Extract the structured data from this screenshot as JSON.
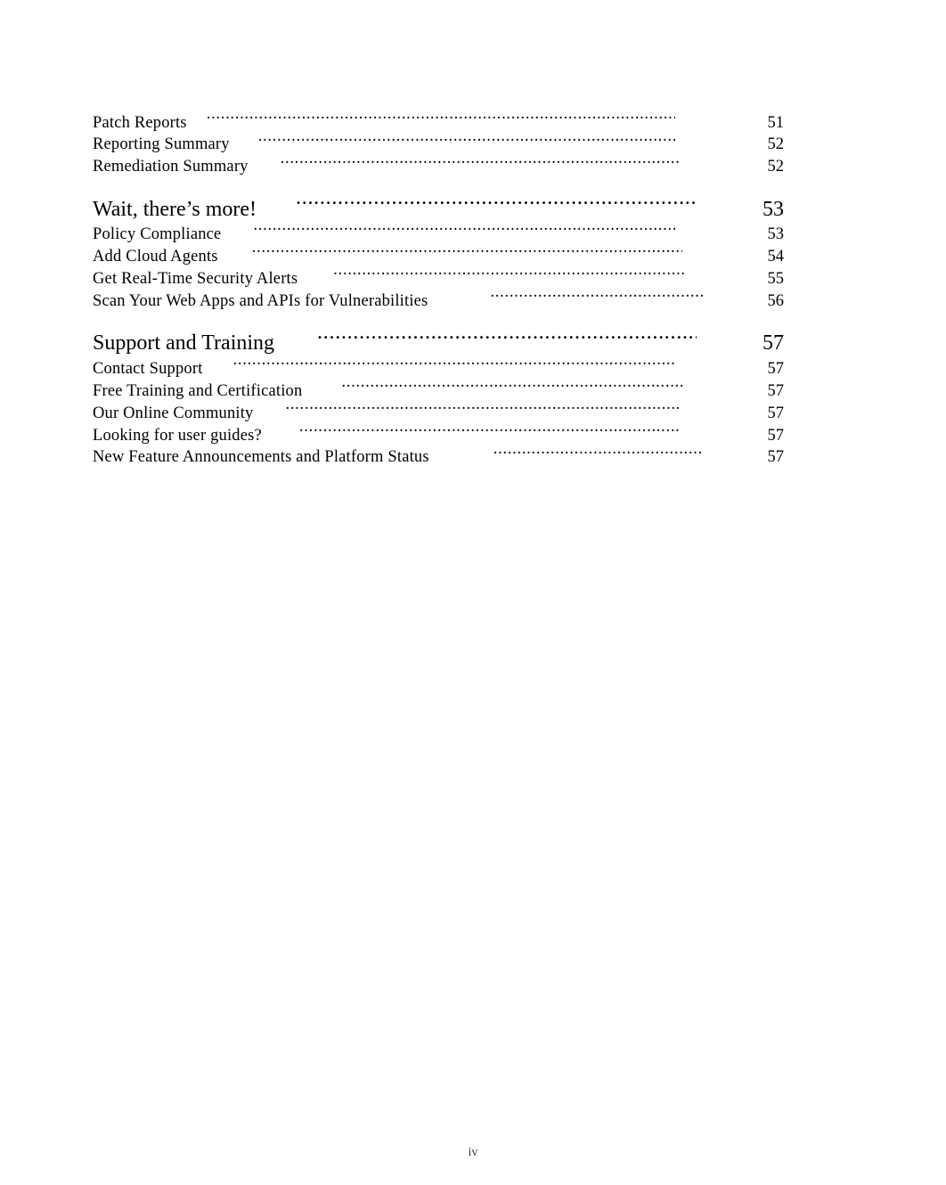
{
  "document": {
    "type": "table-of-contents",
    "footer_page_label": "iv",
    "text_color": "#000000",
    "background_color": "#ffffff"
  },
  "toc": {
    "rows": [
      {
        "kind": "entry",
        "label": "Patch Reports",
        "page": "51",
        "label_gap": 22,
        "tail_gap": 62
      },
      {
        "kind": "entry",
        "label": "Reporting Summary",
        "page": "52",
        "label_gap": 32,
        "tail_gap": 62
      },
      {
        "kind": "entry",
        "label": "Remediation Summary",
        "page": "52",
        "label_gap": 36,
        "tail_gap": 56
      },
      {
        "kind": "gap"
      },
      {
        "kind": "heading",
        "label": "Wait, there’s more!",
        "page": "53",
        "label_gap": 44,
        "tail_gap": 38
      },
      {
        "kind": "entry",
        "label": "Policy Compliance",
        "page": "53",
        "label_gap": 36,
        "tail_gap": 62
      },
      {
        "kind": "entry",
        "label": "Add Cloud Agents",
        "page": "54",
        "label_gap": 38,
        "tail_gap": 54
      },
      {
        "kind": "entry",
        "label": "Get Real-Time Security Alerts",
        "page": "55",
        "label_gap": 40,
        "tail_gap": 50
      },
      {
        "kind": "entry",
        "label": "Scan Your Web Apps and APIs for Vulnerabilities",
        "page": "56",
        "label_gap": 70,
        "tail_gap": 30
      },
      {
        "kind": "gap"
      },
      {
        "kind": "heading",
        "label": "Support and Training",
        "page": "57",
        "label_gap": 48,
        "tail_gap": 38
      },
      {
        "kind": "entry",
        "label": "Contact Support",
        "page": "57",
        "label_gap": 34,
        "tail_gap": 62
      },
      {
        "kind": "entry",
        "label": "Free Training and Certification",
        "page": "57",
        "label_gap": 44,
        "tail_gap": 52
      },
      {
        "kind": "entry",
        "label": "Our Online Community",
        "page": "57",
        "label_gap": 36,
        "tail_gap": 58
      },
      {
        "kind": "entry",
        "label": "Looking for user guides?",
        "page": "57",
        "label_gap": 42,
        "tail_gap": 56
      },
      {
        "kind": "entry",
        "label": "New Feature Announcements and Platform Status",
        "page": "57",
        "label_gap": 72,
        "tail_gap": 30
      }
    ]
  }
}
